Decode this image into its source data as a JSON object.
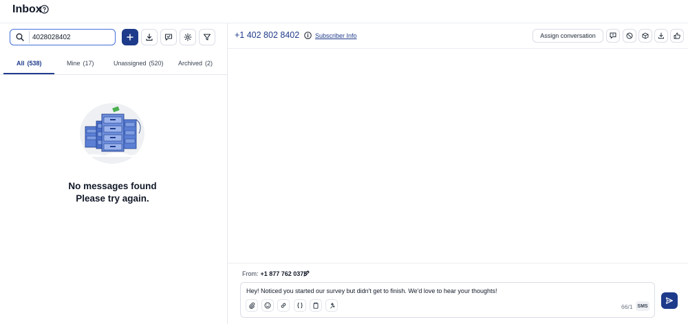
{
  "header": {
    "title": "Inbox",
    "help_icon": "question-circle-icon"
  },
  "search": {
    "value": "4028028402",
    "placeholder": "Search"
  },
  "toolbar": {
    "icons": [
      "plus-icon",
      "download-icon",
      "chat-check-icon",
      "gear-icon",
      "filter-icon"
    ]
  },
  "tabs": [
    {
      "label": "All",
      "count": "(538)",
      "active": true
    },
    {
      "label": "Mine",
      "count": "(17)"
    },
    {
      "label": "Unassigned",
      "count": "(520)"
    },
    {
      "label": "Archived",
      "count": "(2)"
    }
  ],
  "empty_state": {
    "illustration": "filing-cabinets-illustration",
    "title": "No messages found",
    "subtitle": "Please try again."
  },
  "conversation": {
    "phone": "+1 402 802 8402",
    "subscriber_link": "Subscriber Info",
    "assign_label": "Assign conversation",
    "header_icons": [
      "comment-icon",
      "block-icon",
      "box-icon",
      "download-icon",
      "thumbs-up-icon"
    ]
  },
  "composer": {
    "from_label": "From:",
    "from_number": "+1 877 762 0375",
    "message": "Hey! Noticed you started our survey but didn't get to finish. We'd love to hear your thoughts!",
    "char_count": "66/1",
    "channel": "SMS",
    "tool_icons": [
      "paperclip-icon",
      "emoji-icon",
      "link-icon",
      "braces-icon",
      "clipboard-icon",
      "sparkle-icon"
    ]
  },
  "colors": {
    "accent": "#1e3a8a",
    "focus": "#3f6fd8",
    "border": "#d9dde6"
  }
}
